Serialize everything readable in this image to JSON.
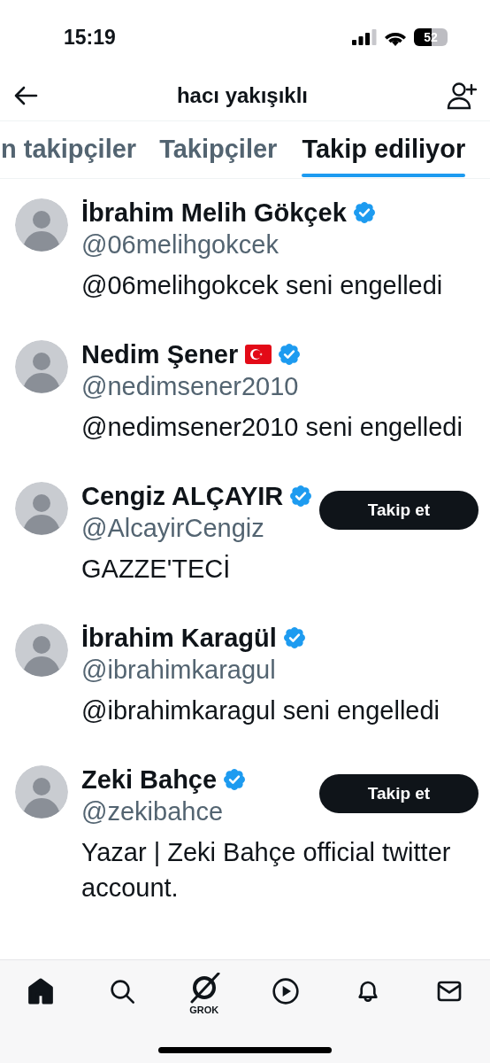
{
  "status_bar": {
    "time": "15:19",
    "battery": "52"
  },
  "header": {
    "title": "hacı yakışıklı"
  },
  "tabs": [
    {
      "label": "n takipçiler",
      "selected": false
    },
    {
      "label": "Takipçiler",
      "selected": false
    },
    {
      "label": "Takip ediliyor",
      "selected": true
    }
  ],
  "accounts": [
    {
      "name": "İbrahim Melih Gökçek",
      "flag": false,
      "verified": true,
      "handle": "@06melihgokcek",
      "bio": "@06melihgokcek seni engelledi"
    },
    {
      "name": "Nedim Şener",
      "flag": true,
      "verified": true,
      "handle": "@nedimsener2010",
      "bio": "@nedimsener2010 seni engelledi"
    },
    {
      "name": "Cengiz ALÇAYIR",
      "flag": false,
      "verified": true,
      "handle": "@AlcayirCengiz",
      "bio": "GAZZE'TECİ",
      "button": "Takip et"
    },
    {
      "name": "İbrahim Karagül",
      "flag": false,
      "verified": true,
      "handle": "@ibrahimkaragul",
      "bio": "@ibrahimkaragul seni engelledi"
    },
    {
      "name": "Zeki Bahçe",
      "flag": false,
      "verified": true,
      "handle": "@zekibahce",
      "bio": "Yazar | Zeki Bahçe official twitter account.",
      "button": "Takip et"
    }
  ],
  "bottom_nav": {
    "items": [
      {
        "kind": "home",
        "selected": true
      },
      {
        "kind": "search",
        "selected": false
      },
      {
        "kind": "grok",
        "label": "GROK",
        "selected": false
      },
      {
        "kind": "video",
        "selected": false
      },
      {
        "kind": "bell",
        "selected": false
      },
      {
        "kind": "mail",
        "selected": false
      }
    ]
  }
}
